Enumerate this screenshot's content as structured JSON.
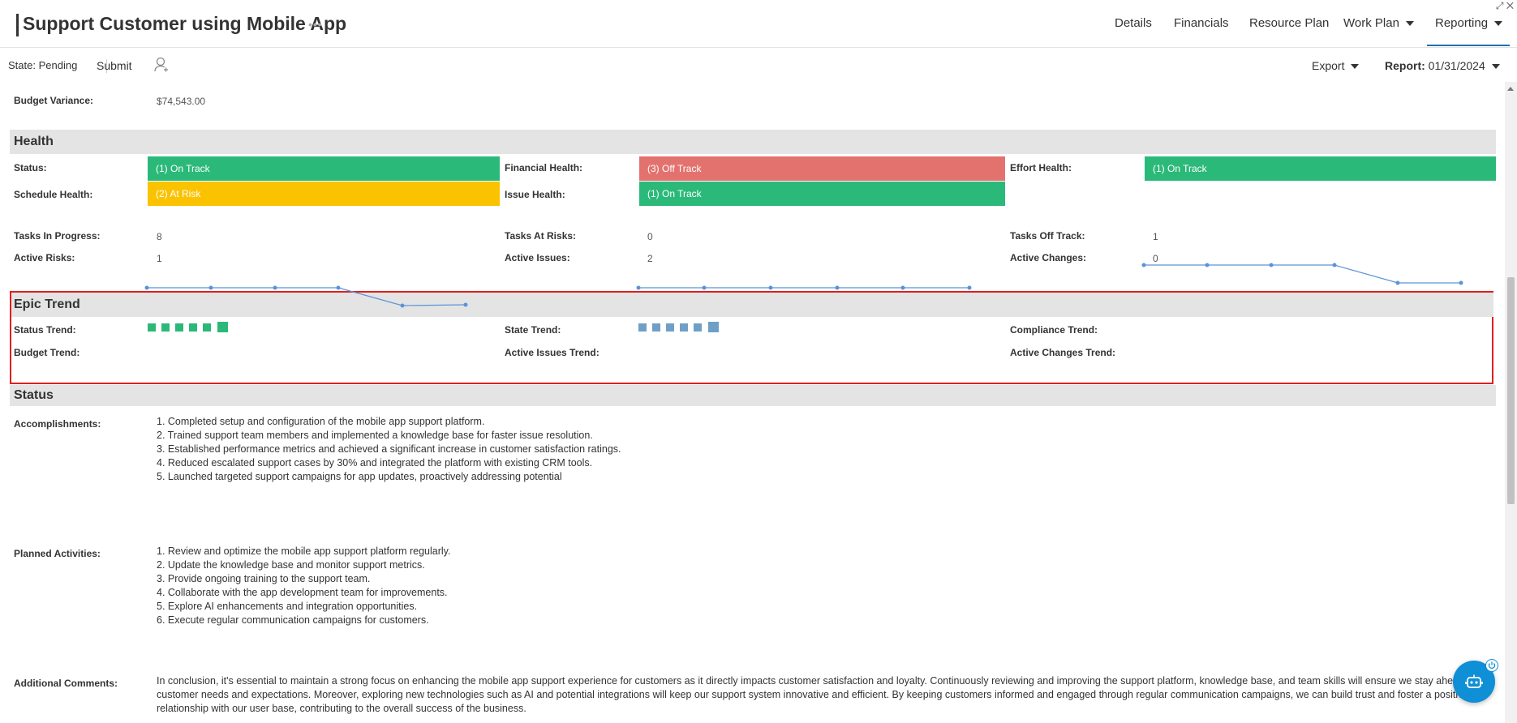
{
  "header": {
    "title": "Support Customer using Mobile App",
    "nav": [
      {
        "label": "Details"
      },
      {
        "label": "Financials"
      },
      {
        "label": "Resource Plan"
      },
      {
        "label": "Work Plan"
      },
      {
        "label": "Reporting"
      }
    ]
  },
  "toolbar": {
    "state_label": "State:",
    "state_value": "Pending",
    "submit_label": "Submit",
    "export_label": "Export",
    "report_label": "Report:",
    "report_date": "01/31/2024"
  },
  "budget": {
    "label": "Budget Variance:",
    "value": "$74,543.00"
  },
  "health": {
    "heading": "Health",
    "status": {
      "label": "Status:",
      "value": "(1) On Track",
      "color": "#2bb979"
    },
    "financial": {
      "label": "Financial Health:",
      "value": "(3) Off Track",
      "color": "#e3726f"
    },
    "effort": {
      "label": "Effort Health:",
      "value": "(1) On Track",
      "color": "#2bb979"
    },
    "schedule": {
      "label": "Schedule Health:",
      "value": "(2) At Risk",
      "color": "#fbc200"
    },
    "issue": {
      "label": "Issue Health:",
      "value": "(1) On Track",
      "color": "#2bb979"
    },
    "tasks_in_progress": {
      "label": "Tasks In Progress:",
      "value": "8"
    },
    "tasks_at_risks": {
      "label": "Tasks At Risks:",
      "value": "0"
    },
    "tasks_off_track": {
      "label": "Tasks Off Track:",
      "value": "1"
    },
    "active_risks": {
      "label": "Active Risks:",
      "value": "1"
    },
    "active_issues": {
      "label": "Active Issues:",
      "value": "2"
    },
    "active_changes": {
      "label": "Active Changes:",
      "value": "0"
    }
  },
  "epic_trend": {
    "heading": "Epic Trend",
    "status_trend": "Status Trend:",
    "state_trend": "State Trend:",
    "compliance_trend": "Compliance Trend:",
    "budget_trend": "Budget Trend:",
    "active_issues_trend": "Active Issues Trend:",
    "active_changes_trend": "Active Changes Trend:",
    "status_color": "#2bb979",
    "state_color": "#6f9fc6",
    "line_color": "#5b93d6"
  },
  "status_section": {
    "heading": "Status",
    "accomplishments_label": "Accomplishments:",
    "accomplishments": [
      "1. Completed setup and configuration of the mobile app support platform.",
      "2. Trained support team members and implemented a knowledge base for faster issue resolution.",
      "3. Established performance metrics and achieved a significant increase in customer satisfaction ratings.",
      "4. Reduced escalated support cases by 30% and integrated the platform with existing CRM tools.",
      "5. Launched targeted support campaigns for app updates, proactively addressing potential"
    ],
    "planned_label": "Planned Activities:",
    "planned": [
      "1. Review and optimize the mobile app support platform regularly.",
      "2. Update the knowledge base and monitor support metrics.",
      "3. Provide ongoing training to the support team.",
      "4. Collaborate with the app development team for improvements.",
      "5. Explore AI enhancements and integration opportunities.",
      "6. Execute regular communication campaigns for customers."
    ],
    "comments_label": "Additional Comments:",
    "comments": "In conclusion, it's essential to maintain a strong focus on enhancing the mobile app support experience for customers as it directly impacts customer satisfaction and loyalty. Continuously reviewing and improving the support platform, knowledge base, and team skills will ensure we stay ahead of customer needs and expectations. Moreover, exploring new technologies such as AI and potential integrations will keep our support system innovative and efficient. By keeping customers informed and engaged through regular communication campaigns, we can build trust and foster a positive relationship with our user base, contributing to the overall success of the business."
  }
}
